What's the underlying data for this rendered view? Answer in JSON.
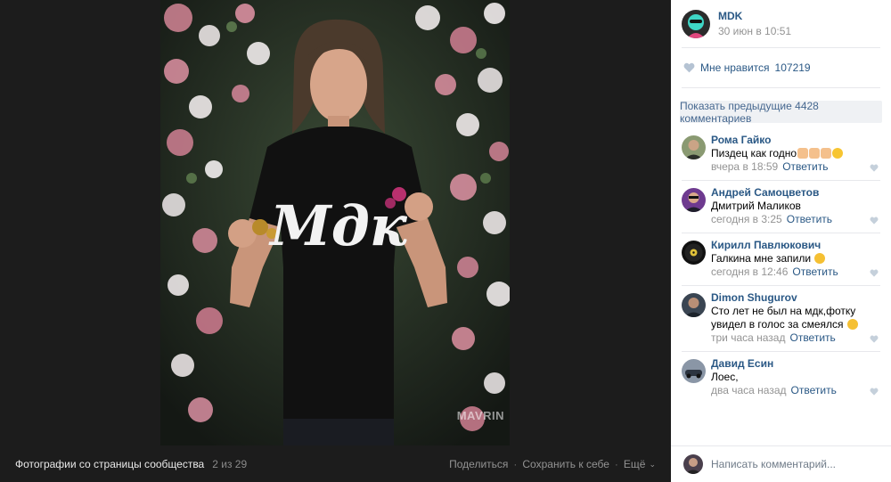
{
  "photo": {
    "watermark": "MAVRIN",
    "album_title": "Фотографии со страницы сообщества",
    "counter": "2 из 29",
    "actions": {
      "share": "Поделиться",
      "save": "Сохранить к себе",
      "more": "Ещё"
    }
  },
  "post": {
    "author": "MDK",
    "date": "30 июн в 10:51",
    "likes_label": "Мне нравится",
    "likes_count": "107219",
    "show_previous": "Показать предыдущие 4428 комментариев"
  },
  "comments": [
    {
      "author": "Рома Гайко",
      "text": "Пиздец как годно",
      "emoji": [
        "thumbs-up",
        "thumbs-up",
        "thumbs-up",
        "kissing-face"
      ],
      "time": "вчера в 18:59",
      "reply": "Ответить"
    },
    {
      "author": "Андрей Самоцветов",
      "text": "Дмитрий Маликов",
      "emoji": [],
      "time": "сегодня в 3:25",
      "reply": "Ответить"
    },
    {
      "author": "Кирилл Павлюкович",
      "text": "Галкина мне запили",
      "emoji": [
        "worried-face"
      ],
      "time": "сегодня в 12:46",
      "reply": "Ответить"
    },
    {
      "author": "Dimon Shugurov",
      "text": "Сто лет не был на мдк,фотку увидел в голос за смеялся",
      "emoji": [
        "rofl-face"
      ],
      "time": "три часа назад",
      "reply": "Ответить"
    },
    {
      "author": "Давид Есин",
      "text": "Лоес,",
      "emoji": [],
      "time": "два часа назад",
      "reply": "Ответить"
    }
  ],
  "comment_input": {
    "placeholder": "Написать комментарий..."
  },
  "colors": {
    "link": "#2a5885",
    "meta": "#939393",
    "panel_bg": "#ffffff",
    "viewer_bg": "#1c1c1c"
  }
}
